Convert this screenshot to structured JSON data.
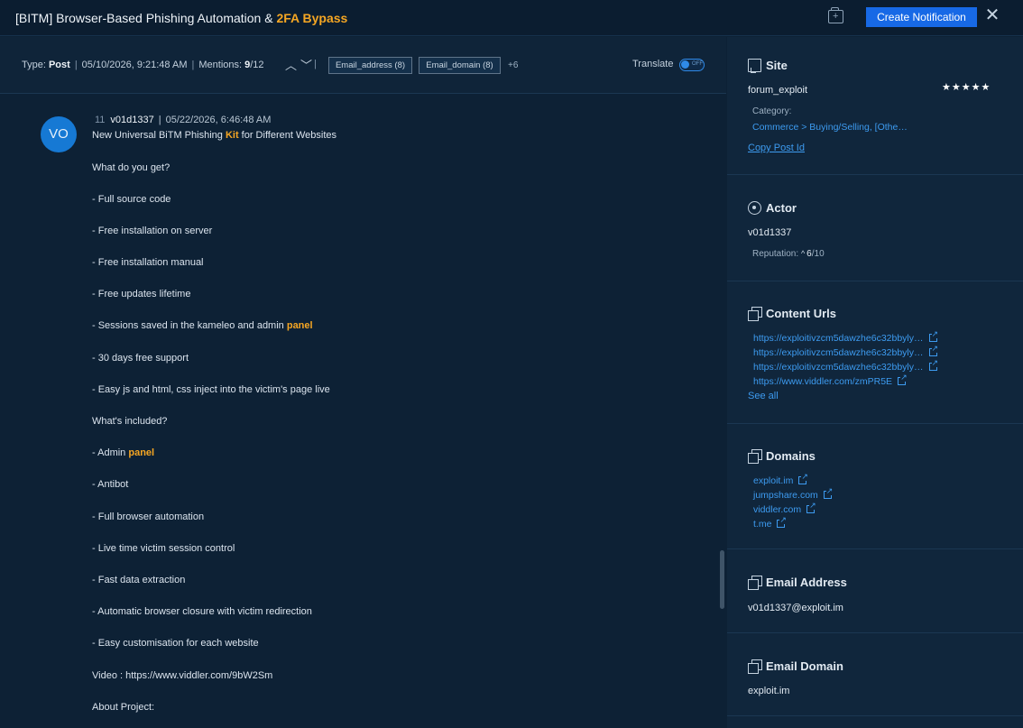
{
  "header": {
    "title_prefix": "[BITM] Browser-Based Phishing Automation & ",
    "title_highlight": "2FA Bypass",
    "create_button": "Create Notification",
    "close_glyph": "✕"
  },
  "meta": {
    "type_label": "Type:",
    "type_value": "Post",
    "date": "05/10/2026, 9:21:48 AM",
    "mentions_label": "Mentions:",
    "mentions_current": "9",
    "mentions_total": "/12",
    "tags": [
      "Email_address (8)",
      "Email_domain (8)"
    ],
    "more_tags": "+6",
    "translate_label": "Translate",
    "translate_state": "OFF"
  },
  "post": {
    "avatar_initials": "VO",
    "post_id": "11",
    "author": "v01d1337",
    "date": "05/22/2026, 6:46:48 AM",
    "lines": [
      {
        "pre": "New Universal  BiTM  Phishing ",
        "hl": "Kit",
        "post": " for Different Websites"
      },
      {
        "pre": "What do you get?"
      },
      {
        "pre": "- Full source code"
      },
      {
        "pre": "- Free installation on server"
      },
      {
        "pre": "- Free installation manual"
      },
      {
        "pre": "- Free updates lifetime"
      },
      {
        "pre": "- Sessions saved in the kameleo and admin ",
        "hl": "panel"
      },
      {
        "pre": "- 30 days free support"
      },
      {
        "pre": "- Easy js and html, css inject into the victim's page live"
      },
      {
        "pre": "What's included?"
      },
      {
        "pre": "- Admin ",
        "hl": "panel"
      },
      {
        "pre": "- Antibot"
      },
      {
        "pre": "- Full browser automation"
      },
      {
        "pre": "- Live time victim session control"
      },
      {
        "pre": "- Fast data extraction"
      },
      {
        "pre": "- Automatic browser closure with victim redirection"
      },
      {
        "pre": "- Easy customisation for each website"
      },
      {
        "pre": "Video :  https://www.viddler.com/9bW2Sm"
      },
      {
        "pre": "About Project:"
      }
    ]
  },
  "panel": {
    "site": {
      "title": "Site",
      "name": "forum_exploit",
      "stars": "★★★★★",
      "category_label": "Category:",
      "category_value": "Commerce > Buying/Selling, [Othe…",
      "copy_link": "Copy Post Id"
    },
    "actor": {
      "title": "Actor",
      "name": "v01d1337",
      "reputation_label": "Reputation:",
      "reputation_value": "6",
      "reputation_total": "/10"
    },
    "content_urls": {
      "title": "Content Urls",
      "urls": [
        "https://exploitivzcm5dawzhe6c32bbyly…",
        "https://exploitivzcm5dawzhe6c32bbyly…",
        "https://exploitivzcm5dawzhe6c32bbyly…",
        "https://www.viddler.com/zmPR5E"
      ],
      "see_all": "See all"
    },
    "domains": {
      "title": "Domains",
      "items": [
        "exploit.im",
        "jumpshare.com",
        "viddler.com",
        "t.me"
      ]
    },
    "email_address": {
      "title": "Email Address",
      "value": "v01d1337@exploit.im"
    },
    "email_domain": {
      "title": "Email Domain",
      "value": "exploit.im"
    }
  }
}
